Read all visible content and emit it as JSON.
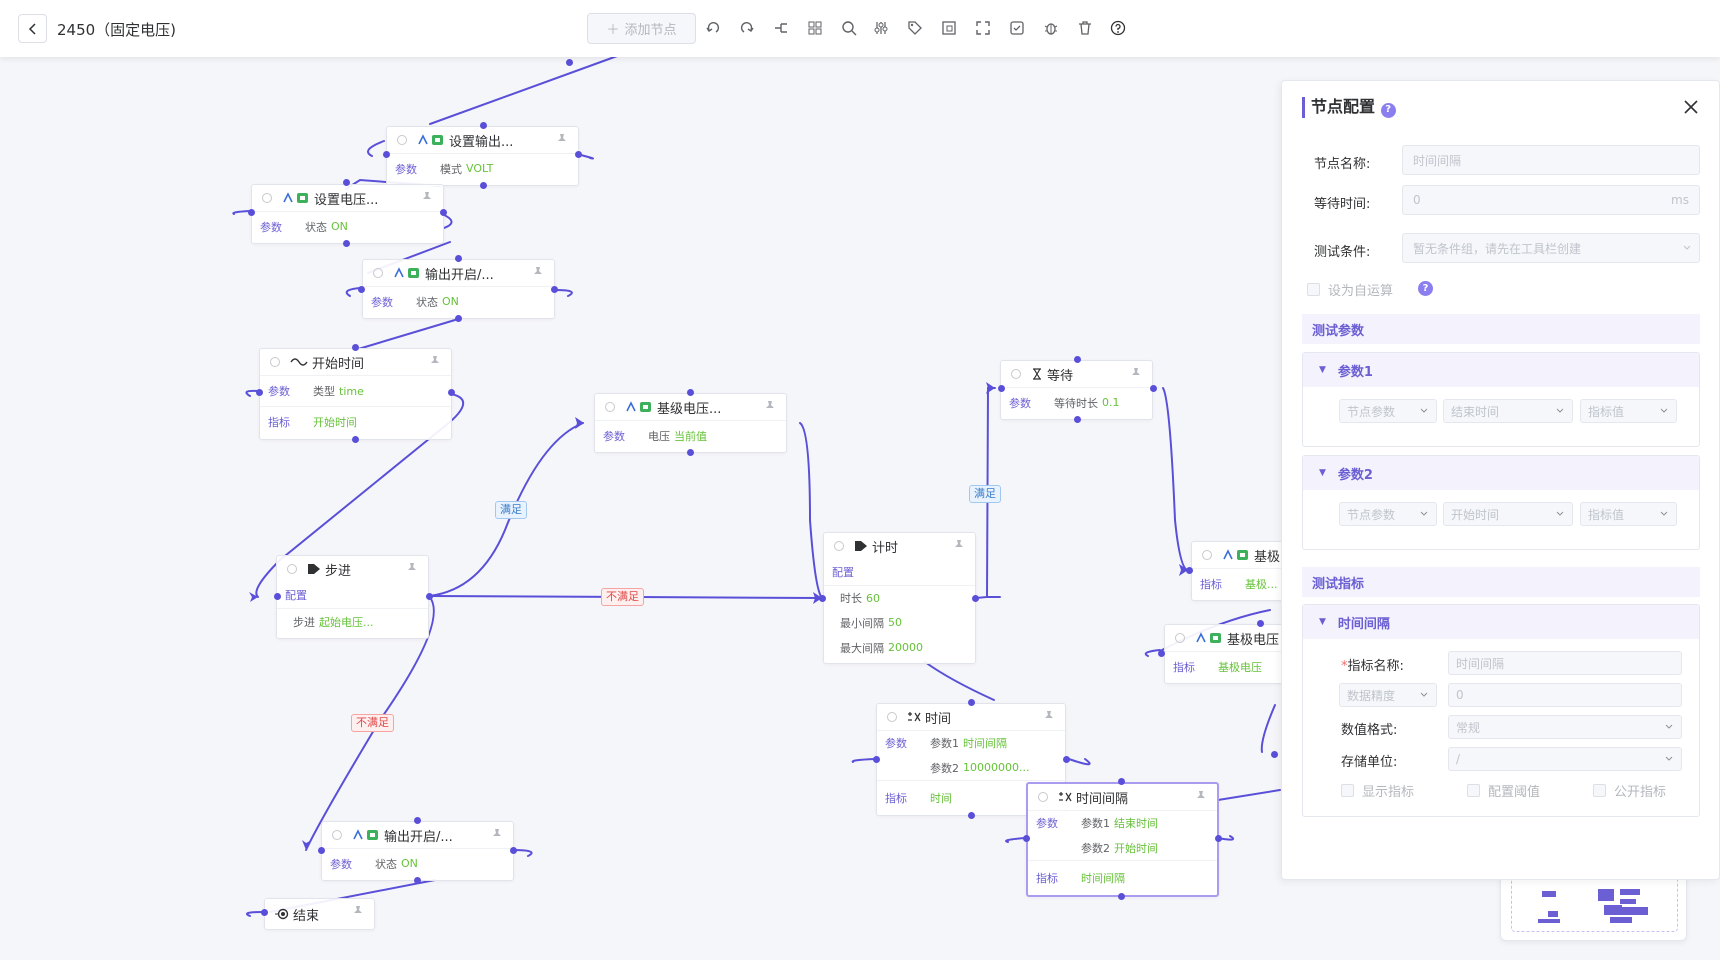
{
  "header": {
    "title": "2450（固定电压)",
    "add_node_label": "添加节点",
    "toolbar_icons": [
      "undo-icon",
      "redo-icon",
      "branch-icon",
      "layout-icon",
      "search-icon",
      "filter-icon",
      "tag-icon",
      "frame-icon",
      "fullscreen-icon",
      "save-icon",
      "debug-icon",
      "delete-icon",
      "help-icon"
    ]
  },
  "nodes": {
    "n1": {
      "title": "设置输出...",
      "row1_key": "参数",
      "row1_p": "模式",
      "row1_v": "VOLT"
    },
    "n2": {
      "title": "设置电压...",
      "row1_key": "参数",
      "row1_p": "状态",
      "row1_v": "ON"
    },
    "n3": {
      "title": "输出开启/...",
      "row1_key": "参数",
      "row1_p": "状态",
      "row1_v": "ON"
    },
    "n4": {
      "title": "开始时间",
      "row1_key": "参数",
      "row1_p": "类型",
      "row1_v": "time",
      "row2_key": "指标",
      "row2_v": "开始时间"
    },
    "n5": {
      "title": "基级电压...",
      "row1_key": "参数",
      "row1_p": "电压",
      "row1_v": "当前值"
    },
    "n6": {
      "title": "步进",
      "row1_key": "配置",
      "row2_p": "步进",
      "row2_v": "起始电压..."
    },
    "n7": {
      "title": "计时",
      "row1_key": "配置",
      "r1_p": "时长",
      "r1_v": "60",
      "r2_p": "最小间隔",
      "r2_v": "50",
      "r3_p": "最大间隔",
      "r3_v": "20000"
    },
    "n8": {
      "title": "等待",
      "row1_key": "参数",
      "row1_p": "等待时长",
      "row1_v": "0.1"
    },
    "n9": {
      "title": "基极",
      "row1_key": "指标",
      "row1_v": "基极..."
    },
    "n10": {
      "title": "基极电压",
      "row1_key": "指标",
      "row1_v": "基极电压"
    },
    "n11": {
      "title": "时间",
      "row1_key": "参数",
      "r1_p": "参数1",
      "r1_v": "时间间隔",
      "r2_p": "参数2",
      "r2_v": "10000000...",
      "row2_key": "指标",
      "row2_v": "时间"
    },
    "n12": {
      "title": "时间间隔",
      "row1_key": "参数",
      "r1_p": "参数1",
      "r1_v": "结束时间",
      "r2_p": "参数2",
      "r2_v": "开始时间",
      "row2_key": "指标",
      "row2_v": "时间间隔"
    },
    "n13": {
      "title": "输出开启/...",
      "row1_key": "参数",
      "row1_p": "状态",
      "row1_v": "ON"
    },
    "n14": {
      "title": "结束"
    }
  },
  "edge_labels": {
    "yes1": "满足",
    "no1": "不满足",
    "no2": "不满足",
    "yes2": "满足"
  },
  "panel": {
    "title": "节点配置",
    "node_name_label": "节点名称:",
    "node_name_placeholder": "时间间隔",
    "wait_label": "等待时间:",
    "wait_value": "0",
    "wait_unit": "ms",
    "cond_label": "测试条件:",
    "cond_placeholder": "暂无条件组，请先在工具栏创建",
    "self_calc_label": "设为自运算",
    "test_params_title": "测试参数",
    "param1": {
      "title": "参数1",
      "s1": "节点参数",
      "s2": "结束时间",
      "s3": "指标值"
    },
    "param2": {
      "title": "参数2",
      "s1": "节点参数",
      "s2": "开始时间",
      "s3": "指标值"
    },
    "test_metrics_title": "测试指标",
    "metric": {
      "title": "时间间隔",
      "name_label": "指标名称:",
      "name_placeholder": "时间间隔",
      "precision_label": "数据精度",
      "precision_value": "0",
      "format_label": "数值格式:",
      "format_value": "常规",
      "unit_label": "存储单位:",
      "unit_value": "/",
      "show_label": "显示指标",
      "threshold_label": "配置阈值",
      "public_label": "公开指标"
    }
  }
}
